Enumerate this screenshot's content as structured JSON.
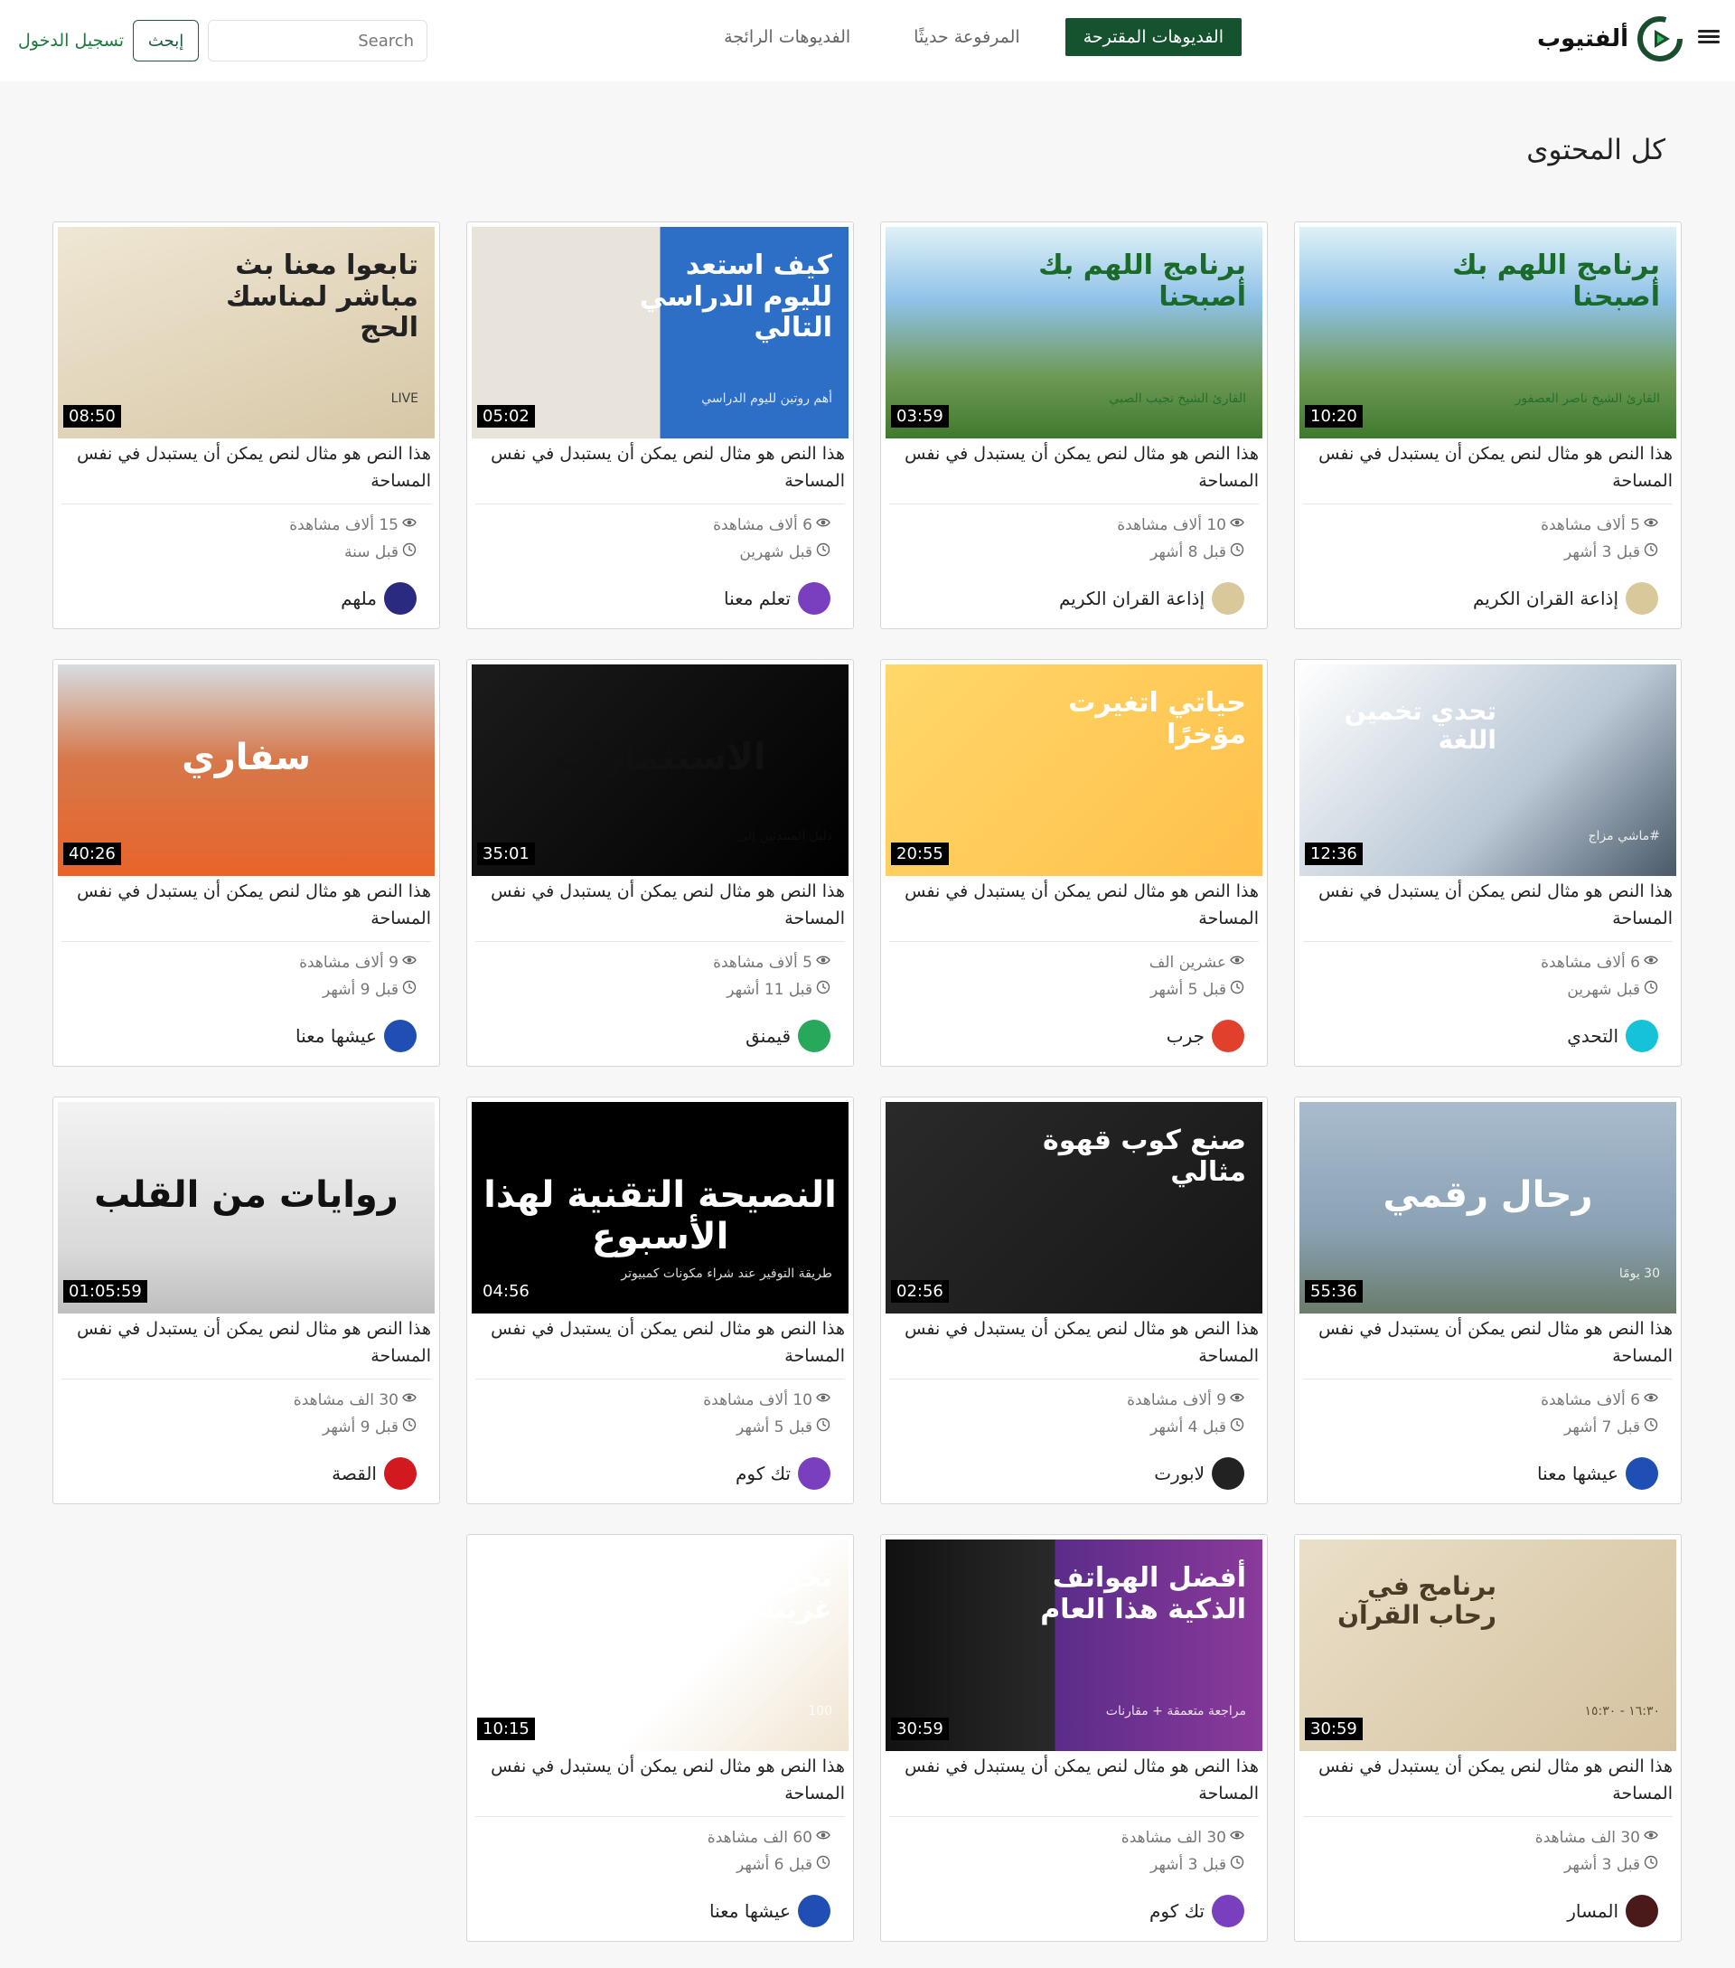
{
  "brand": {
    "name": "ألفتيوب"
  },
  "nav": {
    "tabs": [
      {
        "label": "الفديوهات المقترحة"
      },
      {
        "label": "المرفوعة حديثًا"
      },
      {
        "label": "الفديوهات الرائجة"
      }
    ]
  },
  "search": {
    "placeholder": "Search",
    "button": "إبحث"
  },
  "auth": {
    "login": "تسجيل الدخول"
  },
  "section": {
    "title": "كل المحتوى"
  },
  "colors": {
    "accent": "#14532d",
    "link": "#1b7a3e"
  },
  "videos": [
    {
      "title": "هذا النص هو مثال لنص يمكن أن يستبدل في نفس المساحة",
      "duration": "10:20",
      "views": "5 ألاف مشاهدة",
      "age": "قبل 3 أشهر",
      "channel": "إذاعة القران الكريم",
      "thumb_text": "برنامج اللهم بك أصبحنا",
      "thumb_sub": "القارئ الشيخ ناصر العصفور"
    },
    {
      "title": "هذا النص هو مثال لنص يمكن أن يستبدل في نفس المساحة",
      "duration": "03:59",
      "views": "10 ألاف مشاهدة",
      "age": "قبل 8 أشهر",
      "channel": "إذاعة القران الكريم",
      "thumb_text": "برنامج اللهم بك أصبحنا",
      "thumb_sub": "القارئ الشيخ نجيب الصبي"
    },
    {
      "title": "هذا النص هو مثال لنص يمكن أن يستبدل في نفس المساحة",
      "duration": "05:02",
      "views": "6 ألاف مشاهدة",
      "age": "قبل شهرين",
      "channel": "تعلم معنا",
      "thumb_text": "كيف استعد لليوم الدراسي التالي",
      "thumb_sub": "أهم روتين لليوم الدراسي"
    },
    {
      "title": "هذا النص هو مثال لنص يمكن أن يستبدل في نفس المساحة",
      "duration": "08:50",
      "views": "15 ألاف مشاهدة",
      "age": "قبل سنة",
      "channel": "ملهم",
      "thumb_text": "تابعوا معنا بث مباشر لمناسك الحج",
      "thumb_sub": "LIVE"
    },
    {
      "title": "هذا النص هو مثال لنص يمكن أن يستبدل في نفس المساحة",
      "duration": "12:36",
      "views": "6 ألاف مشاهدة",
      "age": "قبل شهرين",
      "channel": "التحدي",
      "thumb_text": "تحدي تخمين اللغة",
      "thumb_sub": "#ماشي مزاج"
    },
    {
      "title": "هذا النص هو مثال لنص يمكن أن يستبدل في نفس المساحة",
      "duration": "20:55",
      "views": "عشرين الف",
      "age": "قبل 5 أشهر",
      "channel": "جرب",
      "thumb_text": "حياتي اتغيرت مؤخرًا",
      "thumb_sub": ""
    },
    {
      "title": "هذا النص هو مثال لنص يمكن أن يستبدل في نفس المساحة",
      "duration": "35:01",
      "views": "5 ألاف مشاهدة",
      "age": "قبل 11 أشهر",
      "channel": "قيمنق",
      "thumb_text": "الاستثمارات",
      "thumb_sub": "دليل المبتدئين إلى"
    },
    {
      "title": "هذا النص هو مثال لنص يمكن أن يستبدل في نفس المساحة",
      "duration": "40:26",
      "views": "9 ألاف مشاهدة",
      "age": "قبل 9 أشهر",
      "channel": "عيشها معنا",
      "thumb_text": "سفاري",
      "thumb_sub": ""
    },
    {
      "title": "هذا النص هو مثال لنص يمكن أن يستبدل في نفس المساحة",
      "duration": "55:36",
      "views": "6 ألاف مشاهدة",
      "age": "قبل 7 أشهر",
      "channel": "عيشها معنا",
      "thumb_text": "رحال رقمي",
      "thumb_sub": "30 يومًا"
    },
    {
      "title": "هذا النص هو مثال لنص يمكن أن يستبدل في نفس المساحة",
      "duration": "02:56",
      "views": "9 ألاف مشاهدة",
      "age": "قبل 4 أشهر",
      "channel": "لابورت",
      "thumb_text": "صنع كوب قهوة مثالي",
      "thumb_sub": ""
    },
    {
      "title": "هذا النص هو مثال لنص يمكن أن يستبدل في نفس المساحة",
      "duration": "04:56",
      "views": "10 ألاف مشاهدة",
      "age": "قبل 5 أشهر",
      "channel": "تك كوم",
      "thumb_text": "النصيحة التقنية لهذا الأسبوع",
      "thumb_sub": "طريقة التوفير عند شراء مكونات كمبيوتر"
    },
    {
      "title": "هذا النص هو مثال لنص يمكن أن يستبدل في نفس المساحة",
      "duration": "01:05:59",
      "views": "30 الف مشاهدة",
      "age": "قبل 9 أشهر",
      "channel": "القصة",
      "thumb_text": "روايات من القلب",
      "thumb_sub": ""
    },
    {
      "title": "هذا النص هو مثال لنص يمكن أن يستبدل في نفس المساحة",
      "duration": "30:59",
      "views": "30 الف مشاهدة",
      "age": "قبل 3 أشهر",
      "channel": "المسار",
      "thumb_text": "برنامج في رحاب القرآن",
      "thumb_sub": "١٦:٣٠ - ١٥:٣٠"
    },
    {
      "title": "هذا النص هو مثال لنص يمكن أن يستبدل في نفس المساحة",
      "duration": "30:59",
      "views": "30 الف مشاهدة",
      "age": "قبل 3 أشهر",
      "channel": "تك كوم",
      "thumb_text": "أفضل الهواتف الذكية هذا العام",
      "thumb_sub": "مراجعة متعمقة + مقارنات"
    },
    {
      "title": "هذا النص هو مثال لنص يمكن أن يستبدل في نفس المساحة",
      "duration": "10:15",
      "views": "60 الف مشاهدة",
      "age": "قبل 6 أشهر",
      "channel": "عيشها معنا",
      "thumb_text": "تجربة أطعمة غريبة",
      "thumb_sub": "100"
    }
  ]
}
